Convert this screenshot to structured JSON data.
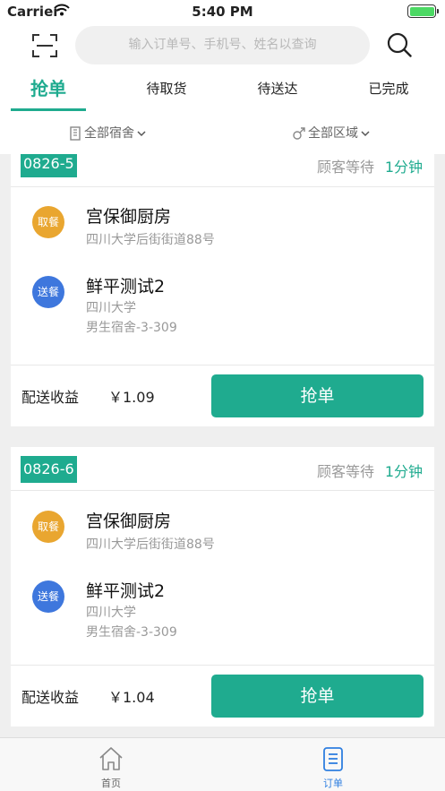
{
  "status_bar": {
    "carrier": "Carrier",
    "time": "5:40 PM"
  },
  "search": {
    "placeholder": "输入订单号、手机号、姓名以查询"
  },
  "tabs": [
    {
      "label": "抢单",
      "active": true
    },
    {
      "label": "待取货",
      "active": false
    },
    {
      "label": "待送达",
      "active": false
    },
    {
      "label": "已完成",
      "active": false
    }
  ],
  "filters": {
    "dorm": "全部宿舍",
    "area": "全部区域"
  },
  "orders": [
    {
      "order_no": "0826-5",
      "wait_label": "顾客等待",
      "wait_time": "1分钟",
      "pickup": {
        "badge": "取餐",
        "name": "宫保御厨房",
        "address": "四川大学后街街道88号"
      },
      "delivery": {
        "badge": "送餐",
        "name": "鲜平测试2",
        "line1": "四川大学",
        "line2": "男生宿舍-3-309"
      },
      "earnings_label": "配送收益",
      "earnings": "￥1.09",
      "button": "抢单"
    },
    {
      "order_no": "0826-6",
      "wait_label": "顾客等待",
      "wait_time": "1分钟",
      "pickup": {
        "badge": "取餐",
        "name": "宫保御厨房",
        "address": "四川大学后街街道88号"
      },
      "delivery": {
        "badge": "送餐",
        "name": "鲜平测试2",
        "line1": "四川大学",
        "line2": "男生宿舍-3-309"
      },
      "earnings_label": "配送收益",
      "earnings": "￥1.04",
      "button": "抢单"
    }
  ],
  "tabbar": [
    {
      "label": "首页",
      "icon": "home-icon",
      "active": false
    },
    {
      "label": "订单",
      "icon": "orders-icon",
      "active": true
    }
  ],
  "colors": {
    "accent": "#1fab8f",
    "pickup": "#e9a630",
    "delivery": "#3e77dd"
  }
}
